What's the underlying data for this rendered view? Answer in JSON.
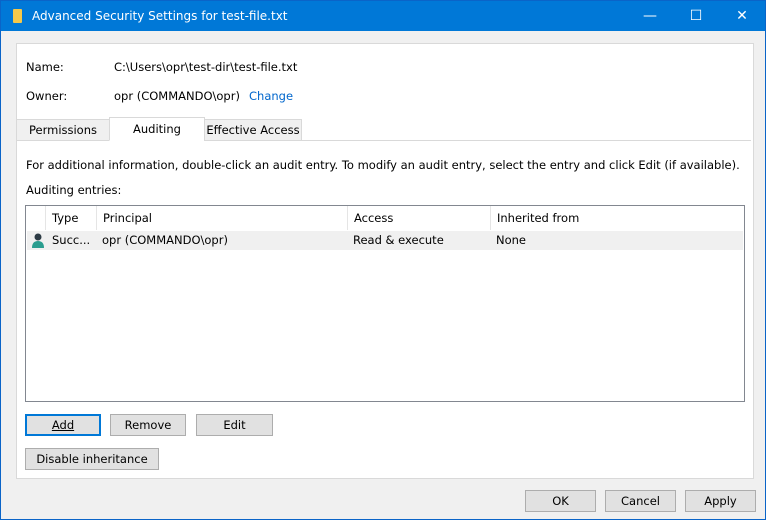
{
  "window": {
    "title": "Advanced Security Settings for test-file.txt",
    "minimize": "—",
    "maximize": "☐",
    "close": "✕"
  },
  "info": {
    "name_label": "Name:",
    "name_value": "C:\\Users\\opr\\test-dir\\test-file.txt",
    "owner_label": "Owner:",
    "owner_value": "opr (COMMANDO\\opr)",
    "change_link": "Change"
  },
  "tabs": [
    {
      "label": "Permissions"
    },
    {
      "label": "Auditing",
      "active": true
    },
    {
      "label": "Effective Access"
    }
  ],
  "auditing": {
    "instructions": "For additional information, double-click an audit entry. To modify an audit entry, select the entry and click Edit (if available).",
    "entries_label": "Auditing entries:",
    "columns": [
      "Type",
      "Principal",
      "Access",
      "Inherited from"
    ],
    "rows": [
      {
        "icon": "user-icon",
        "type": "Succ...",
        "principal": "opr (COMMANDO\\opr)",
        "access": "Read & execute",
        "inherited": "None"
      }
    ]
  },
  "buttons": {
    "add": "Add",
    "remove": "Remove",
    "edit": "Edit",
    "disable_inheritance": "Disable inheritance",
    "ok": "OK",
    "cancel": "Cancel",
    "apply": "Apply"
  },
  "colors": {
    "titlebar": "#0078d7",
    "link": "#0066cc"
  }
}
